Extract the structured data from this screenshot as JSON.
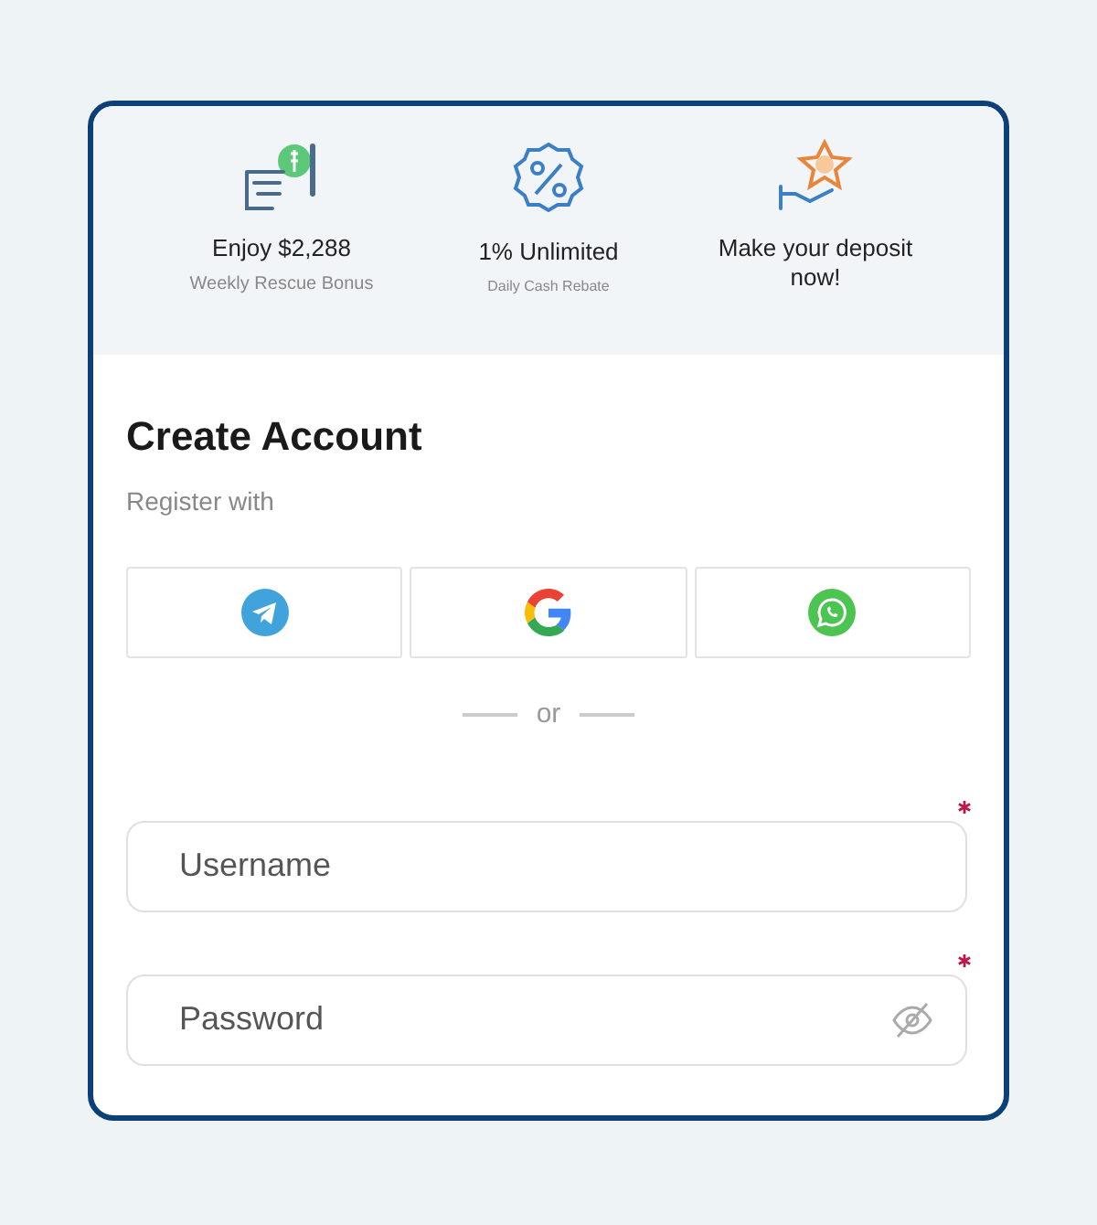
{
  "promos": [
    {
      "kind": "cash",
      "title": "Enjoy $2,288",
      "subtitle": "Weekly Rescue Bonus"
    },
    {
      "kind": "percent",
      "title": "1% Unlimited",
      "subtitle": "Daily Cash Rebate"
    },
    {
      "kind": "deposit",
      "title": "Make your deposit now!"
    }
  ],
  "form": {
    "title": "Create Account",
    "register_label": "Register with",
    "social_buttons": [
      {
        "kind": "telegram"
      },
      {
        "kind": "google"
      },
      {
        "kind": "whatsapp"
      }
    ],
    "divider": "or",
    "fields": [
      {
        "kind": "text",
        "placeholder": "Username",
        "required": true
      },
      {
        "kind": "password",
        "placeholder": "Password",
        "required": true
      }
    ]
  }
}
